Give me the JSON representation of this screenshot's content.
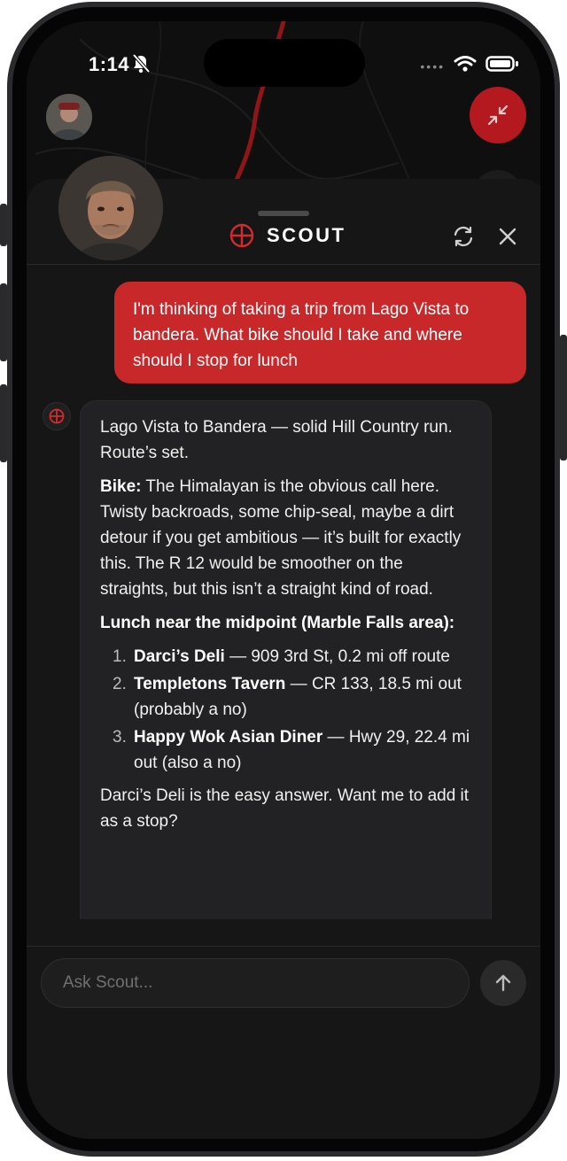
{
  "status_bar": {
    "time": "1:14",
    "bell_icon": "bell-slash-icon",
    "wifi_icon": "wifi-icon",
    "battery_icon": "battery-icon"
  },
  "header": {
    "title": "SCOUT",
    "logo_icon": "crosshair-icon",
    "refresh_icon": "refresh-icon",
    "close_icon": "close-icon"
  },
  "map": {
    "collapse_icon": "collapse-arrows-icon",
    "layers_icon": "layers-icon"
  },
  "messages": {
    "user": "I'm thinking of taking a trip from Lago Vista to bandera. What bike should I take and where should I stop for lunch",
    "bot": {
      "intro": "Lago Vista to Bandera — solid Hill Country run. Route’s set.",
      "bike_label": "Bike:",
      "bike_text": "The Himalayan is the obvious call here. Twisty backroads, some chip-seal, maybe a dirt detour if you get ambitious — it’s built for exactly this. The R 12 would be smoother on the straights, but this isn’t a straight kind of road.",
      "lunch_heading": "Lunch near the midpoint (Marble Falls area):",
      "lunch_options": [
        {
          "num": "1.",
          "name": "Darci’s Deli",
          "detail": " — 909 3rd St, 0.2 mi off route"
        },
        {
          "num": "2.",
          "name": "Templetons Tavern",
          "detail": " — CR 133, 18.5 mi out (probably a no)"
        },
        {
          "num": "3.",
          "name": "Happy Wok Asian Diner",
          "detail": " — Hwy 29, 22.4 mi out (also a no)"
        }
      ],
      "closing": "Darci’s Deli is the easy answer. Want me to add it as a stop?"
    }
  },
  "input": {
    "placeholder": "Ask Scout...",
    "value": "",
    "send_icon": "arrow-up-icon"
  },
  "colors": {
    "accent": "#c8282a",
    "background": "#161616",
    "bubble": "#222224"
  }
}
